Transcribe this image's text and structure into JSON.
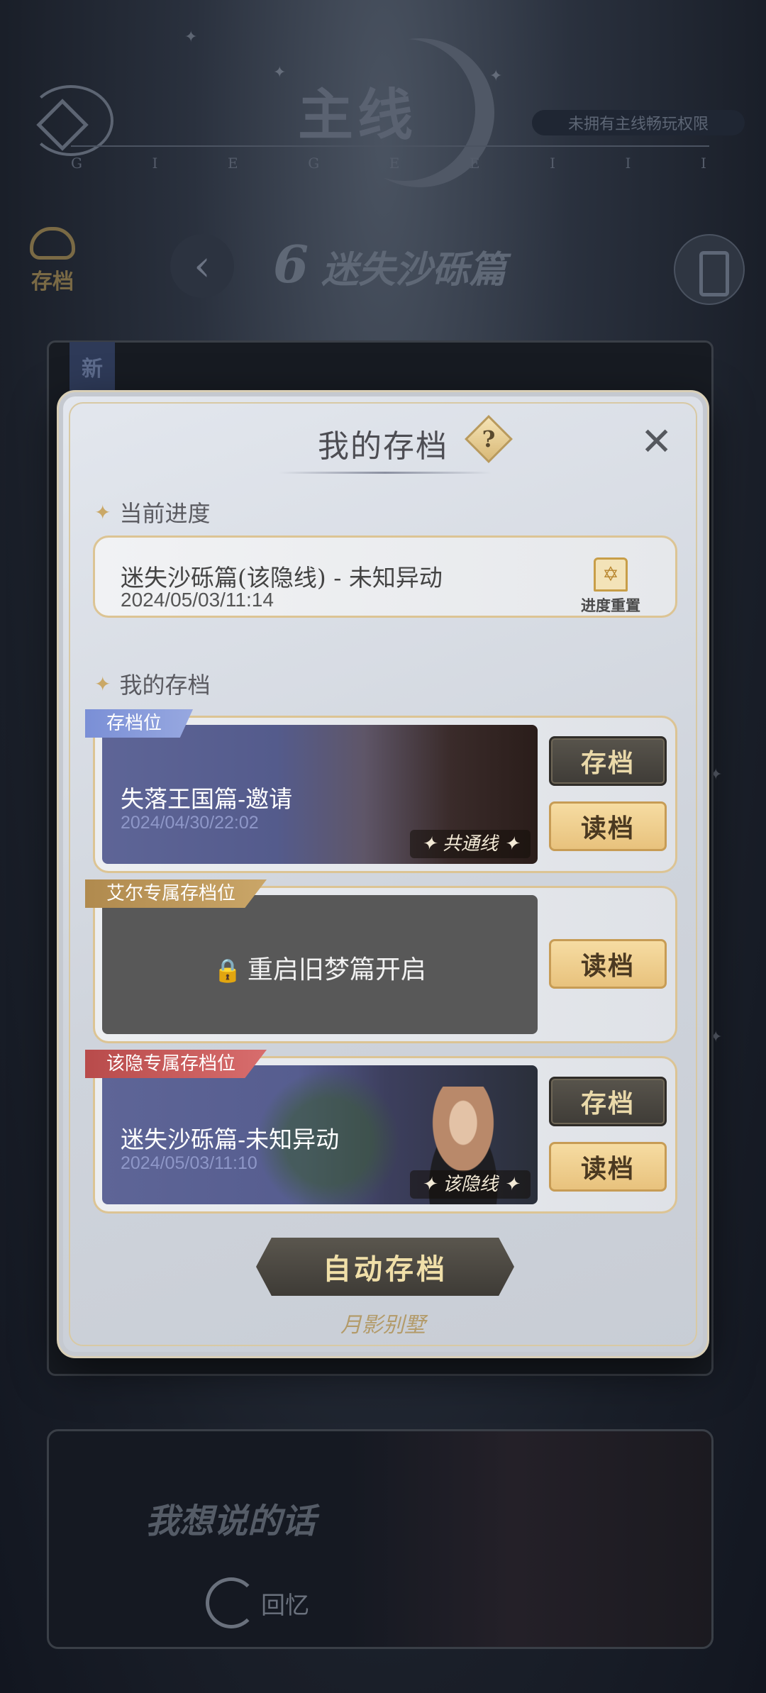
{
  "header": {
    "title": "主线",
    "letters": [
      "G",
      "I",
      "E",
      "G",
      "E",
      "E",
      "I",
      "I",
      "I"
    ],
    "no_permission_badge": "未拥有主线畅玩权限"
  },
  "side": {
    "save_label": "存档"
  },
  "chapter": {
    "number": "6",
    "title": "迷失沙砾篇"
  },
  "background": {
    "new_tag": "新",
    "bottom_title": "我想说的话",
    "memory_label": "回忆"
  },
  "modal": {
    "title": "我的存档",
    "help": "?",
    "close": "✕",
    "current_progress_label": "当前进度",
    "current": {
      "title": "迷失沙砾篇(该隐线) - 未知异动",
      "date": "2024/05/03/11:14",
      "reset_label": "进度重置"
    },
    "my_saves_label": "我的存档",
    "slots": [
      {
        "tag": "存档位",
        "name": "失落王国篇-邀请",
        "date": "2024/04/30/22:02",
        "route": "✦ 共通线 ✦",
        "save_label": "存档",
        "load_label": "读档"
      },
      {
        "tag": "艾尔专属存档位",
        "locked_text": "重启旧梦篇开启",
        "lock_icon": "🔒",
        "load_label": "读档"
      },
      {
        "tag": "该隐专属存档位",
        "name": "迷失沙砾篇-未知异动",
        "date": "2024/05/03/11:10",
        "route": "✦ 该隐线 ✦",
        "save_label": "存档",
        "load_label": "读档"
      }
    ],
    "auto_save_label": "自动存档",
    "logo": "月影别墅"
  },
  "colors": {
    "accent_gold": "#dcc494",
    "dark_button": "#3f3c37",
    "gold_button": "#e8c27d",
    "tag_blue": "#7a8fd6",
    "tag_gold": "#b08a4e",
    "tag_red": "#b84b4b"
  }
}
